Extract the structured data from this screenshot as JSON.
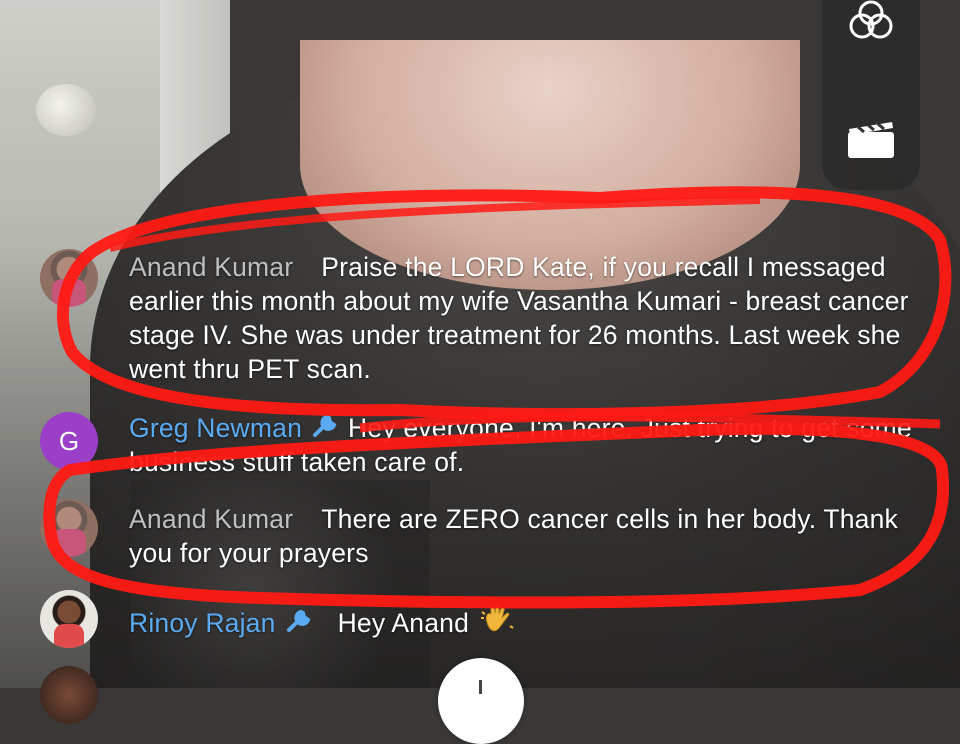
{
  "comments": [
    {
      "author": "Anand Kumar",
      "text": "Praise the LORD Kate, if you recall I messaged earlier this month about my wife Vasantha Kumari - breast cancer stage IV. She was under treatment for 26 months. Last week she went thru PET scan."
    },
    {
      "author": "Greg Newman",
      "avatar_letter": "G",
      "text": "Hey everyone, I'm here. Just trying to get some business stuff taken care of."
    },
    {
      "author": "Anand Kumar",
      "text": "There are ZERO cancer cells in her body. Thank you for your prayers"
    },
    {
      "author": "Rinoy Rajan",
      "text": "Hey Anand"
    }
  ],
  "colors": {
    "author_grey": "#bfbfbf",
    "author_blue": "#5aaaf2",
    "annotation_red": "#ff1a14",
    "avatar_purple": "#9b3ec8"
  },
  "icons": {
    "top_control": "effects-circles-icon",
    "second_control": "clapperboard-icon",
    "moderator_badge": "wrench-icon",
    "emoji": "waving-hand-icon"
  }
}
